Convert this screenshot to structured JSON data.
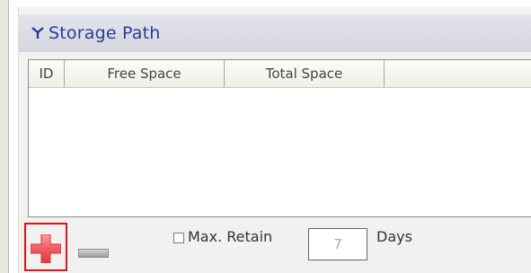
{
  "section": {
    "title": "Storage Path",
    "collapse_icon": "chevron-double-down-icon"
  },
  "table": {
    "columns": [
      "ID",
      "Free Space",
      "Total Space"
    ],
    "rows": []
  },
  "controls": {
    "add_icon": "plus-icon",
    "remove_icon": "minus-icon",
    "retain_checked": false,
    "retain_label": "Max. Retain",
    "days_value": "7",
    "days_label": "Days"
  },
  "colors": {
    "title": "#2a3c98",
    "highlight_border": "#e0131b",
    "add_icon": "#f05a60"
  }
}
